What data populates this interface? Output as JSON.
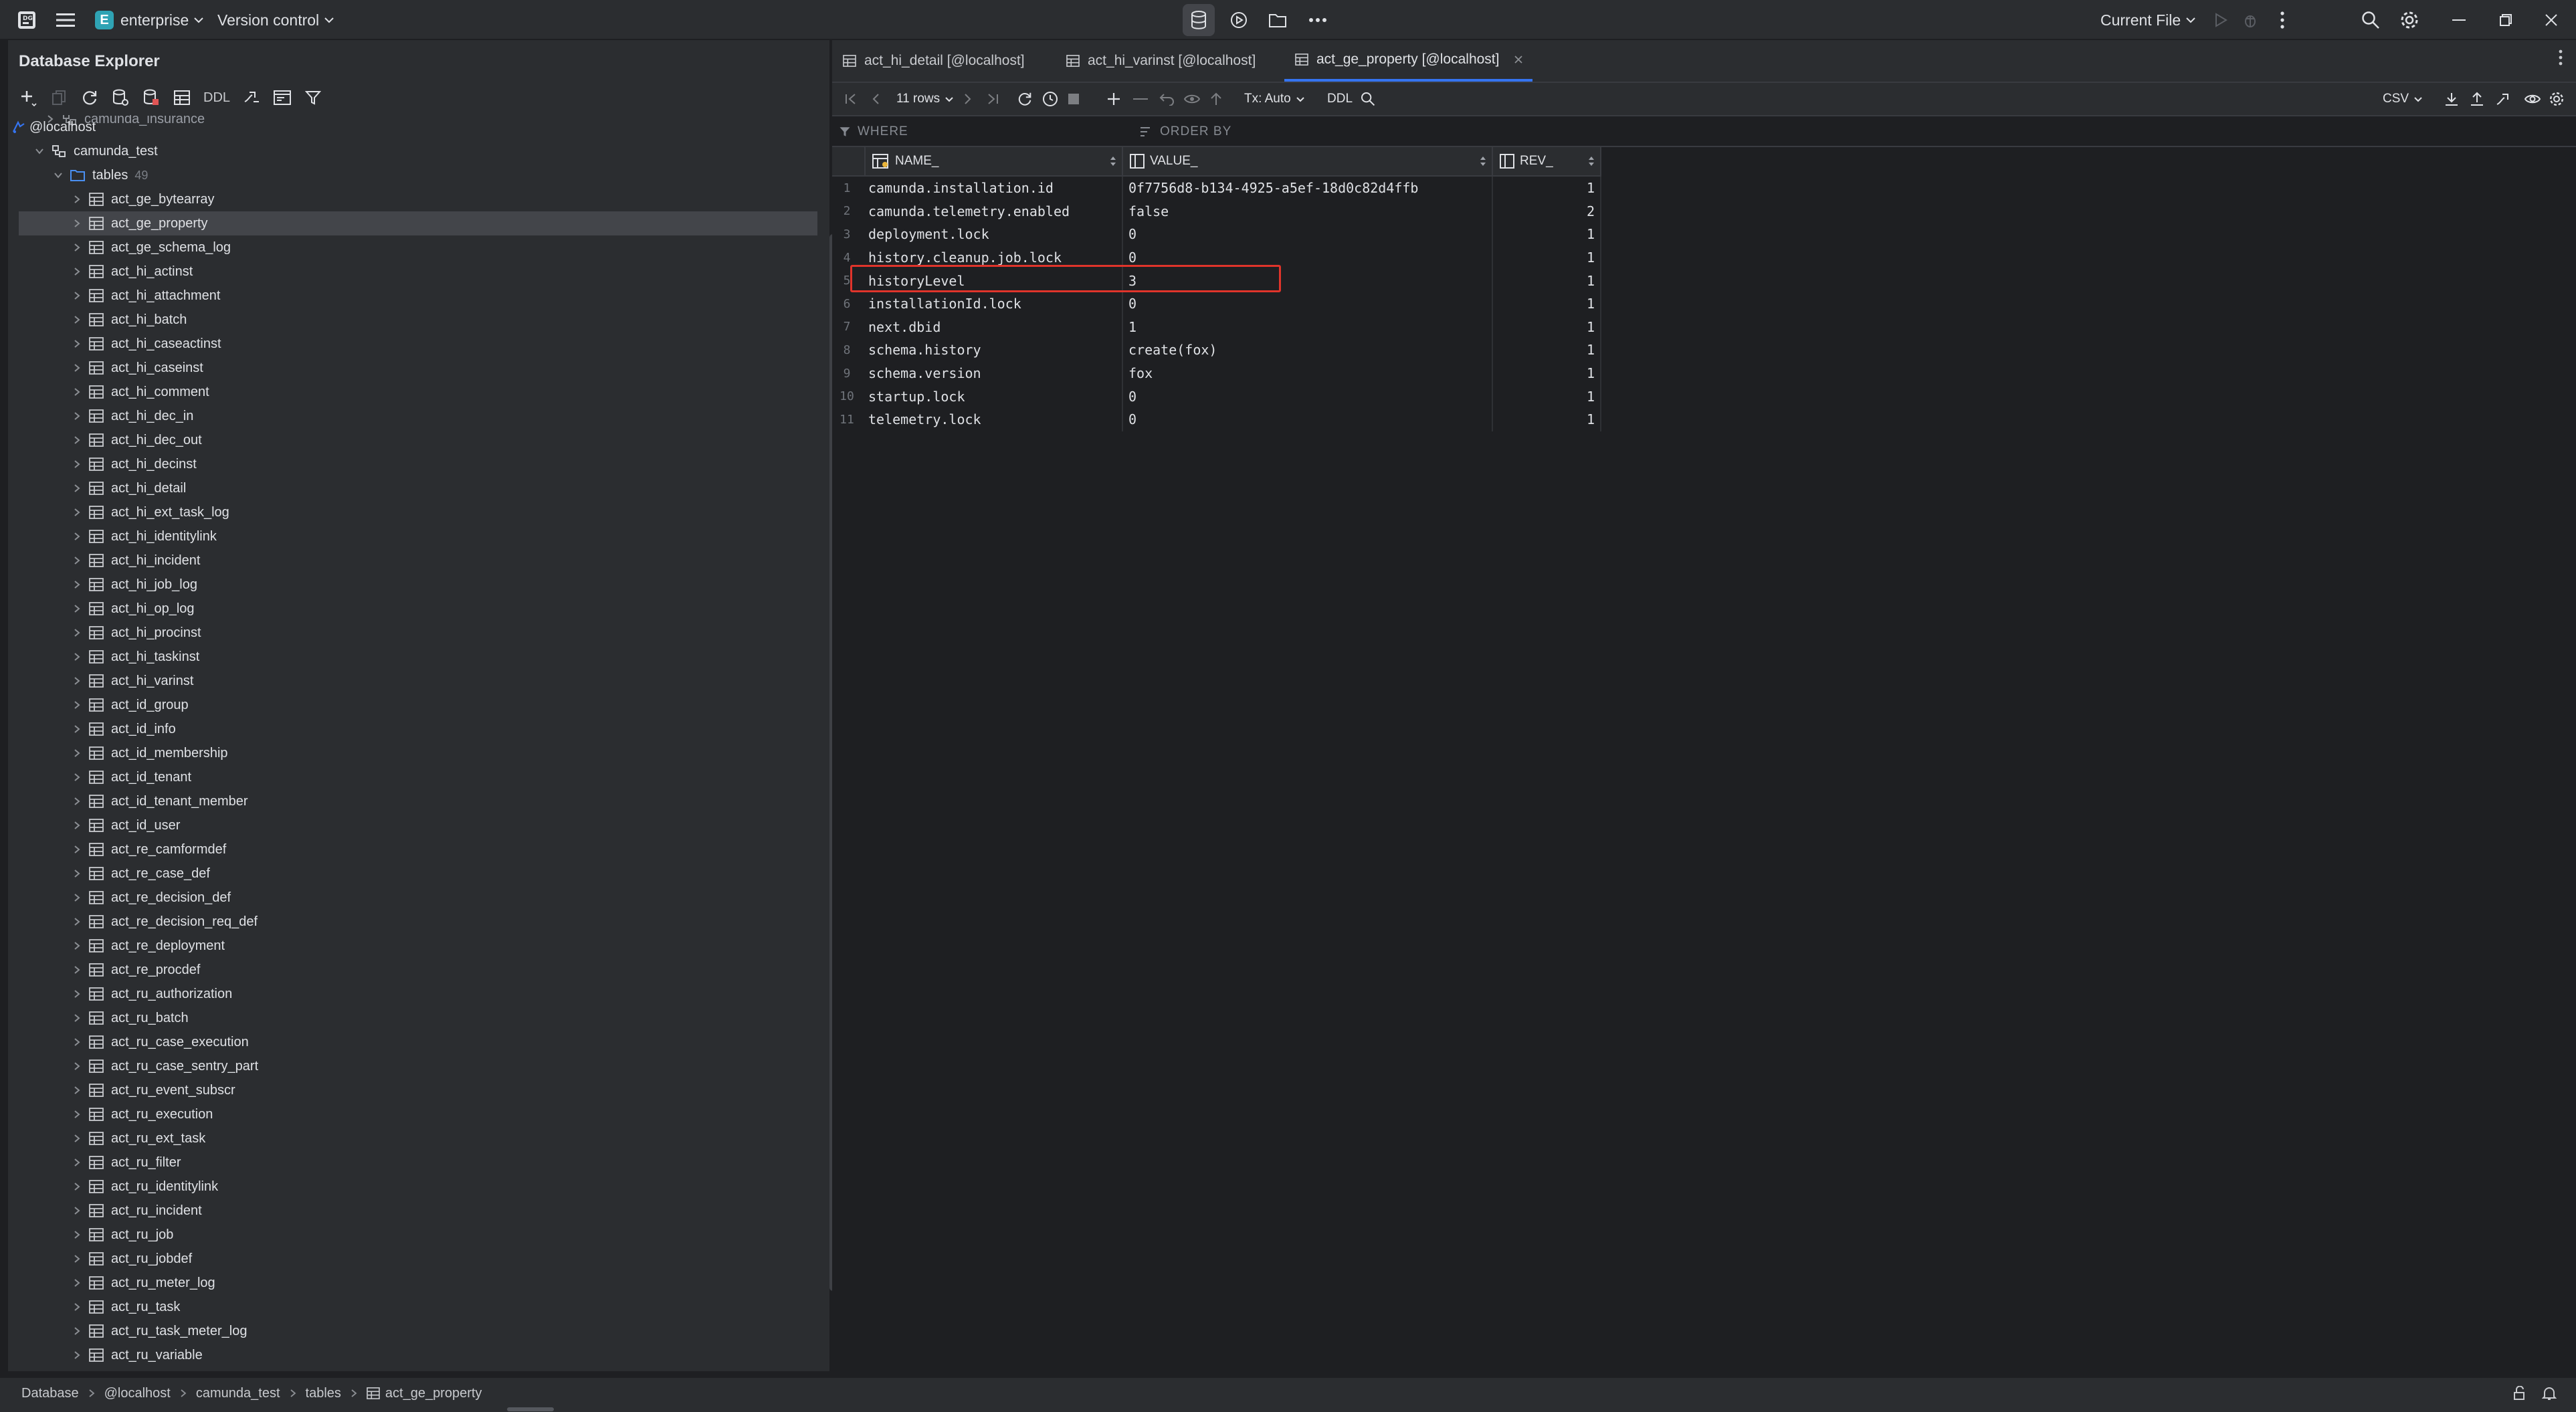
{
  "titlebar": {
    "project_initial": "E",
    "project_name": "enterprise",
    "vcs_label": "Version control",
    "run_config": "Current File"
  },
  "left_panel": {
    "title": "Database Explorer",
    "ddl_label": "DDL",
    "tree": {
      "partial_item": "camunda_insurance",
      "host": "@localhost",
      "schema": "camunda_test",
      "folder": "tables",
      "folder_count": "49",
      "tables": [
        "act_ge_bytearray",
        "act_ge_property",
        "act_ge_schema_log",
        "act_hi_actinst",
        "act_hi_attachment",
        "act_hi_batch",
        "act_hi_caseactinst",
        "act_hi_caseinst",
        "act_hi_comment",
        "act_hi_dec_in",
        "act_hi_dec_out",
        "act_hi_decinst",
        "act_hi_detail",
        "act_hi_ext_task_log",
        "act_hi_identitylink",
        "act_hi_incident",
        "act_hi_job_log",
        "act_hi_op_log",
        "act_hi_procinst",
        "act_hi_taskinst",
        "act_hi_varinst",
        "act_id_group",
        "act_id_info",
        "act_id_membership",
        "act_id_tenant",
        "act_id_tenant_member",
        "act_id_user",
        "act_re_camformdef",
        "act_re_case_def",
        "act_re_decision_def",
        "act_re_decision_req_def",
        "act_re_deployment",
        "act_re_procdef",
        "act_ru_authorization",
        "act_ru_batch",
        "act_ru_case_execution",
        "act_ru_case_sentry_part",
        "act_ru_event_subscr",
        "act_ru_execution",
        "act_ru_ext_task",
        "act_ru_filter",
        "act_ru_identitylink",
        "act_ru_incident",
        "act_ru_job",
        "act_ru_jobdef",
        "act_ru_meter_log",
        "act_ru_task",
        "act_ru_task_meter_log",
        "act_ru_variable"
      ],
      "selected_table": "act_ge_property"
    }
  },
  "editor": {
    "tabs": [
      {
        "label": "act_hi_detail [@localhost]",
        "active": false
      },
      {
        "label": "act_hi_varinst [@localhost]",
        "active": false
      },
      {
        "label": "act_ge_property [@localhost]",
        "active": true
      }
    ],
    "toolbar": {
      "rows_label": "11 rows",
      "tx_label": "Tx: Auto",
      "ddl_label": "DDL",
      "export_format": "CSV"
    },
    "filter": {
      "where_label": "WHERE",
      "order_label": "ORDER BY"
    },
    "grid": {
      "columns": [
        "NAME_",
        "VALUE_",
        "REV_"
      ],
      "rows": [
        {
          "num": "1",
          "name": "camunda.installation.id",
          "value": "0f7756d8-b134-4925-a5ef-18d0c82d4ffb",
          "rev": "1"
        },
        {
          "num": "2",
          "name": "camunda.telemetry.enabled",
          "value": "false",
          "rev": "2"
        },
        {
          "num": "3",
          "name": "deployment.lock",
          "value": "0",
          "rev": "1"
        },
        {
          "num": "4",
          "name": "history.cleanup.job.lock",
          "value": "0",
          "rev": "1"
        },
        {
          "num": "5",
          "name": "historyLevel",
          "value": "3",
          "rev": "1"
        },
        {
          "num": "6",
          "name": "installationId.lock",
          "value": "0",
          "rev": "1"
        },
        {
          "num": "7",
          "name": "next.dbid",
          "value": "1",
          "rev": "1"
        },
        {
          "num": "8",
          "name": "schema.history",
          "value": "create(fox)",
          "rev": "1"
        },
        {
          "num": "9",
          "name": "schema.version",
          "value": "fox",
          "rev": "1"
        },
        {
          "num": "10",
          "name": "startup.lock",
          "value": "0",
          "rev": "1"
        },
        {
          "num": "11",
          "name": "telemetry.lock",
          "value": "0",
          "rev": "1"
        }
      ],
      "highlighted_row": "historyLevel"
    }
  },
  "statusbar": {
    "breadcrumb": [
      "Database",
      "@localhost",
      "camunda_test",
      "tables",
      "act_ge_property"
    ]
  },
  "colors": {
    "accent": "#3574f0",
    "highlight_box": "#e0342b",
    "project_badge": "#2fa3b4",
    "panel_bg": "#2b2d30",
    "editor_bg": "#1e1f22"
  }
}
